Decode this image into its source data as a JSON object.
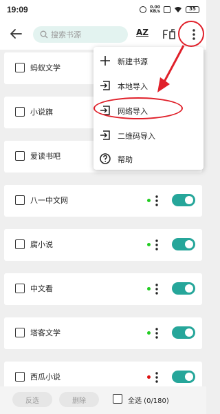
{
  "status_bar": {
    "time": "19:09",
    "speed_value": "0.00",
    "speed_unit": "KB/s",
    "battery": "35"
  },
  "toolbar": {
    "search_placeholder": "搜索书源",
    "sort_label": "AZ"
  },
  "sources": [
    {
      "name": "蚂蚁文学"
    },
    {
      "name": "小说旗"
    },
    {
      "name": "爱读书吧"
    },
    {
      "name": "八一中文网",
      "status": "green",
      "enabled": true
    },
    {
      "name": "腐小说",
      "status": "green",
      "enabled": true
    },
    {
      "name": "中文看",
      "status": "green",
      "enabled": true
    },
    {
      "name": "塔客文学",
      "status": "green",
      "enabled": true
    },
    {
      "name": "西瓜小说",
      "status": "red",
      "enabled": true
    }
  ],
  "menu": {
    "items": [
      {
        "label": "新建书源",
        "icon": "plus-icon"
      },
      {
        "label": "本地导入",
        "icon": "import-icon"
      },
      {
        "label": "网络导入",
        "icon": "import-icon"
      },
      {
        "label": "二维码导入",
        "icon": "import-icon"
      },
      {
        "label": "帮助",
        "icon": "help-icon"
      }
    ]
  },
  "bottom_bar": {
    "invert_label": "反选",
    "delete_label": "删除",
    "select_all_label": "全选 (0/180)"
  },
  "colors": {
    "accent": "#26a69a",
    "status_green": "#22cc22",
    "status_red": "#dd1111",
    "annotation_red": "#e0202a",
    "search_bg": "#e3f3f0"
  }
}
